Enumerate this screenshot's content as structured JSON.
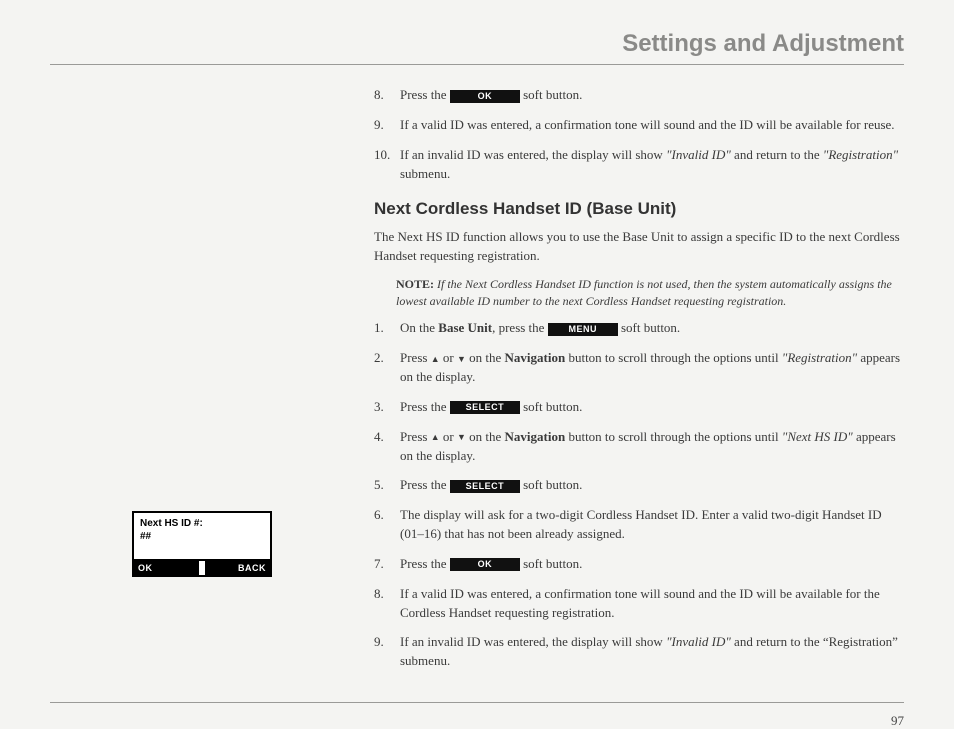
{
  "header": {
    "title": "Settings and Adjustment"
  },
  "buttons": {
    "ok": "OK",
    "menu": "MENU",
    "select": "SELECT"
  },
  "lcd": {
    "line1": "Next HS ID #:",
    "line2": "##",
    "left": "OK",
    "right": "BACK"
  },
  "topSteps": {
    "s8": {
      "num": "8.",
      "pre": "Press the ",
      "post": " soft button."
    },
    "s9": {
      "num": "9.",
      "text": "If a valid ID was entered, a confirmation tone will sound and the ID will be available for reuse."
    },
    "s10": {
      "num": "10.",
      "pre": "If an invalid ID was entered, the display will show ",
      "invalid": "\"Invalid ID\"",
      "mid": " and return to the ",
      "reg": "\"Registration\"",
      "post": " submenu."
    }
  },
  "section": {
    "heading": "Next Cordless Handset ID (Base Unit)",
    "intro": "The Next HS ID function allows you to use the Base Unit to assign a specific ID to the next Cordless Handset requesting registration.",
    "noteLabel": "NOTE:",
    "noteText": " If the Next  Cordless Handset ID function is not used, then the system automatically assigns the lowest available ID number to the next Cordless Handset requesting registration."
  },
  "steps": {
    "s1": {
      "num": "1.",
      "a": "On the ",
      "base": "Base Unit",
      "b": ", press the ",
      "c": " soft button."
    },
    "s2": {
      "num": "2.",
      "a": "Press ",
      "b": " or ",
      "c": " on the ",
      "nav": "Navigation",
      "d": " button to scroll through the options until ",
      "reg": "\"Registration\"",
      "e": " appears on the display."
    },
    "s3": {
      "num": "3.",
      "a": "Press the ",
      "b": " soft button."
    },
    "s4": {
      "num": "4.",
      "a": "Press ",
      "b": " or ",
      "c": " on the ",
      "nav": "Navigation",
      "d": " button to scroll through the options until ",
      "hs": "\"Next HS ID\"",
      "e": " appears on the display."
    },
    "s5": {
      "num": "5.",
      "a": "Press the ",
      "b": " soft button."
    },
    "s6": {
      "num": "6.",
      "text": "The display will ask for a two-digit Cordless Handset ID. Enter a valid two-digit Handset ID (01–16) that has not been already assigned."
    },
    "s7": {
      "num": "7.",
      "a": "Press the ",
      "b": " soft button."
    },
    "s8": {
      "num": "8.",
      "text": "If a valid ID was entered, a confirmation tone will sound and the ID will be available for the Cordless Handset requesting registration."
    },
    "s9": {
      "num": "9.",
      "a": "If an invalid ID was entered, the display will show ",
      "invalid": "\"Invalid ID\"",
      "b": " and return to the “Registration” submenu."
    }
  },
  "pageNumber": "97"
}
